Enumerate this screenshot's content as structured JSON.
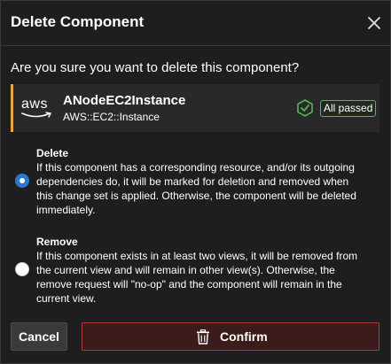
{
  "dialog": {
    "title": "Delete Component",
    "question": "Are you sure you want to delete this component?"
  },
  "component": {
    "logo_text": "aws",
    "name": "ANodeEC2Instance",
    "type": "AWS::EC2::Instance",
    "status_label": "All passed",
    "accent_color": "#e8a33d",
    "status_color": "#56b356"
  },
  "options": [
    {
      "title": "Delete",
      "selected": true,
      "description": "If this component has a corresponding resource, and/or its outgoing dependencies do, it will be marked for deletion and removed when this change set is applied. Otherwise, the component will be deleted immediately."
    },
    {
      "title": "Remove",
      "selected": false,
      "description": "If this component exists in at least two views, it will be removed from the current view and will remain in other view(s). Otherwise, the remove request will \"no-op\" and the component will remain in the current view."
    }
  ],
  "buttons": {
    "cancel_label": "Cancel",
    "confirm_label": "Confirm",
    "confirm_color": "#b03a3a"
  },
  "icons": {
    "close": "close-icon",
    "check": "check-hexagon-icon",
    "trash": "trash-icon"
  }
}
